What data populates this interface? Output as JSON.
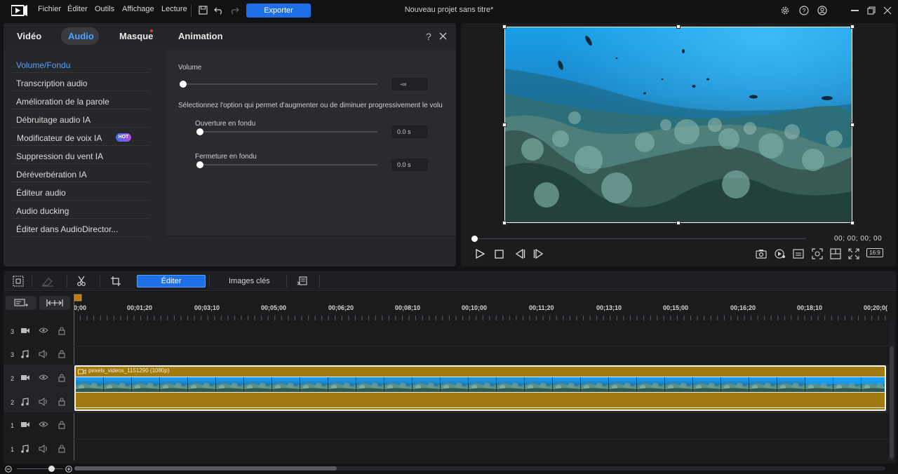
{
  "menu": [
    "Fichier",
    "Éditer",
    "Outils",
    "Affichage",
    "Lecture"
  ],
  "export_label": "Exporter",
  "project_title": "Nouveau projet sans titre*",
  "tabs": [
    "Vidéo",
    "Audio",
    "Masque",
    "Animation"
  ],
  "active_tab": "Audio",
  "panel_help": "?",
  "sidebar": {
    "items": [
      "Volume/Fondu",
      "Transcription audio",
      "Amélioration de la parole",
      "Débruitage audio IA",
      "Modificateur de voix IA",
      "Suppression du vent IA",
      "Déréverbération IA",
      "Éditeur audio",
      "Audio ducking",
      "Éditer dans AudioDirector..."
    ],
    "active_index": 0,
    "hot_badge": "HOT"
  },
  "volume": {
    "label": "Volume",
    "value": "-∞",
    "fade_hint": "Sélectionnez l'option qui permet d'augmenter ou de diminuer progressivement le volu",
    "fade_in_label": "Ouverture en fondu",
    "fade_in_value": "0.0 s",
    "fade_out_label": "Fermeture en fondu",
    "fade_out_value": "0.0 s"
  },
  "player": {
    "timecode": "00; 00; 00; 00",
    "aspect": "16:9"
  },
  "timeline_toolbar": {
    "edit_label": "Éditer",
    "keyframes_label": "Images clés"
  },
  "ruler_labels": [
    "0;00",
    "00;01;20",
    "00;03;10",
    "00;05;00",
    "00;06;20",
    "00;08;10",
    "00;10;00",
    "00;11;20",
    "00;13;10",
    "00;15;00",
    "00;16;20",
    "00;18;10",
    "00;20;0("
  ],
  "tracks": [
    {
      "num": "3",
      "kind": "video"
    },
    {
      "num": "3",
      "kind": "audio"
    },
    {
      "num": "2",
      "kind": "video"
    },
    {
      "num": "2",
      "kind": "audio"
    },
    {
      "num": "1",
      "kind": "video"
    },
    {
      "num": "1",
      "kind": "audio"
    }
  ],
  "clip": {
    "name": "pexels_videos_1151290 (1080p)"
  },
  "colors": {
    "accent": "#1e6fe6",
    "clip_gold": "#a07a0e",
    "active_text": "#4ea3ff",
    "playhead": "#d8322b"
  }
}
